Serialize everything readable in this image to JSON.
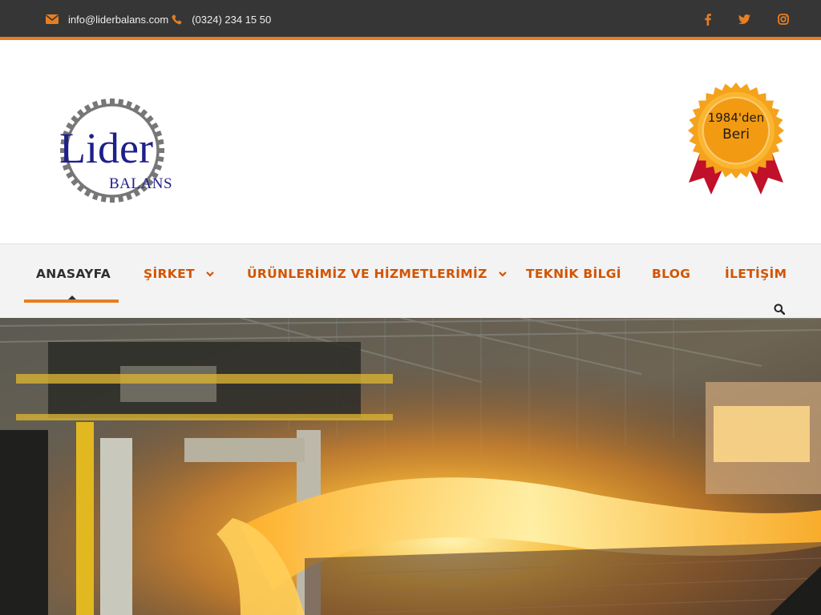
{
  "topbar": {
    "email": "info@liderbalans.com",
    "phone": "(0324) 234 15 50",
    "email_icon": "envelope-icon",
    "phone_icon": "phone-icon",
    "social": [
      "facebook-icon",
      "twitter-icon",
      "instagram-icon"
    ]
  },
  "header": {
    "logo_title": "Lider",
    "logo_subtitle": "BALANS",
    "badge_line1": "1984'den",
    "badge_line2": "Beri"
  },
  "nav": {
    "items": [
      {
        "label": "ANASAYFA",
        "active": true
      },
      {
        "label": "ŞİRKET",
        "dropdown": true
      },
      {
        "label": "ÜRÜNLERİMİZ VE HİZMETLERİMİZ",
        "dropdown": true
      },
      {
        "label": "TEKNİK BİLGİ"
      },
      {
        "label": "BLOG"
      },
      {
        "label": "İLETİŞİM"
      }
    ],
    "search_icon": "search-icon"
  },
  "colors": {
    "accent": "#e67e22",
    "nav_text": "#d35400",
    "topbar_bg": "#363636",
    "logo_blue": "#1f1f8a",
    "badge_gold": "#f5a21c",
    "ribbon_red": "#c0102a"
  }
}
